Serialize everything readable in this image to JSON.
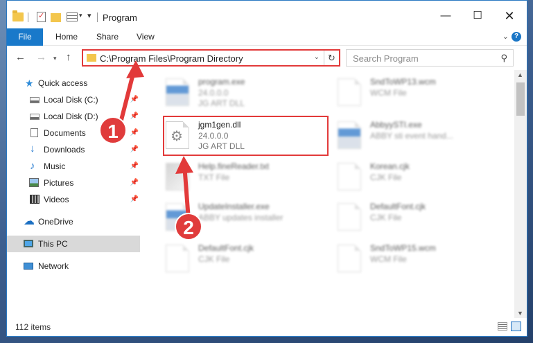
{
  "window": {
    "title": "Program",
    "controls": {
      "minimize": "—",
      "maximize": "☐",
      "close": "✕"
    }
  },
  "ribbon": {
    "tabs": [
      "File",
      "Home",
      "Share",
      "View"
    ],
    "help": "?"
  },
  "address": {
    "path": "C:\\Program Files\\Program Directory",
    "search_placeholder": "Search Program"
  },
  "sidebar": {
    "quick_access": "Quick access",
    "items": [
      {
        "label": "Local Disk (C:)",
        "pinned": true
      },
      {
        "label": "Local Disk (D:)",
        "pinned": true
      },
      {
        "label": "Documents",
        "pinned": true
      },
      {
        "label": "Downloads",
        "pinned": true
      },
      {
        "label": "Music",
        "pinned": true
      },
      {
        "label": "Pictures",
        "pinned": true
      },
      {
        "label": "Videos",
        "pinned": true
      }
    ],
    "onedrive": "OneDrive",
    "this_pc": "This PC",
    "network": "Network"
  },
  "files": [
    {
      "name": "program.exe",
      "line1": "24.0.0.0",
      "line2": "JG ART DLL",
      "icon": "app-icon"
    },
    {
      "name": "SndToWP13.wcm",
      "line1": "WCM File",
      "line2": "",
      "icon": "file-icon"
    },
    {
      "name": "jgm1gen.dll",
      "line1": "24.0.0.0",
      "line2": "JG ART DLL",
      "icon": "dll-gear-icon"
    },
    {
      "name": "AbbyySTI.exe",
      "line1": "ABBY sti event hand...",
      "line2": "",
      "icon": "app-icon"
    },
    {
      "name": "Help.fineReader.txt",
      "line1": "TXT File",
      "line2": "",
      "icon": "file-icon"
    },
    {
      "name": "Korean.cjk",
      "line1": "CJK File",
      "line2": "",
      "icon": "file-icon"
    },
    {
      "name": "UpdateInstaller.exe",
      "line1": "ABBY updates installer",
      "line2": "",
      "icon": "app-icon"
    },
    {
      "name": "DefaultFont.cjk",
      "line1": "CJK File",
      "line2": "",
      "icon": "file-icon"
    },
    {
      "name": "DefaultFont.cjk",
      "line1": "CJK File",
      "line2": "",
      "icon": "file-icon"
    },
    {
      "name": "SndToWP15.wcm",
      "line1": "WCM File",
      "line2": "",
      "icon": "file-icon"
    }
  ],
  "status": {
    "count": "112 items"
  },
  "callouts": [
    "1",
    "2"
  ],
  "colors": {
    "accent": "#1979ca",
    "highlight": "#e23a3a"
  }
}
